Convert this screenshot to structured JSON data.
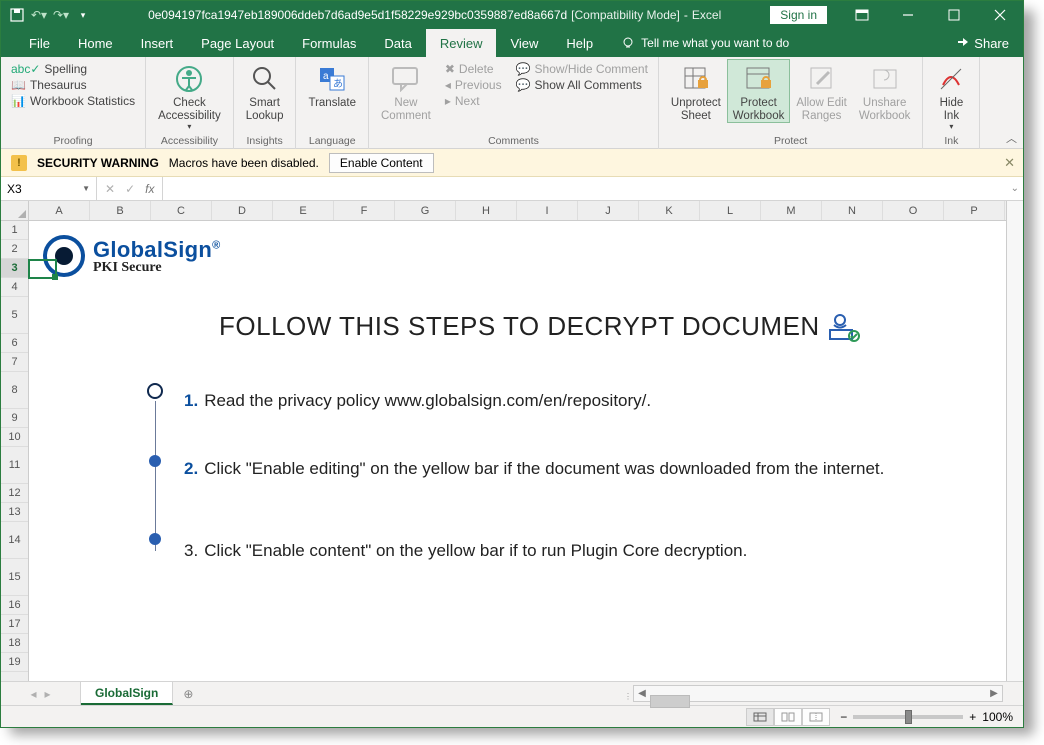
{
  "titlebar": {
    "docname": "0e094197fca1947eb189006ddeb7d6ad9e5d1f58229e929bc0359887ed8a667d",
    "mode": "[Compatibility Mode]",
    "app": "Excel",
    "signin": "Sign in"
  },
  "menu": {
    "tabs": [
      "File",
      "Home",
      "Insert",
      "Page Layout",
      "Formulas",
      "Data",
      "Review",
      "View",
      "Help"
    ],
    "active": "Review",
    "tellme": "Tell me what you want to do",
    "share": "Share"
  },
  "ribbon": {
    "proofing": {
      "label": "Proofing",
      "items": [
        "Spelling",
        "Thesaurus",
        "Workbook Statistics"
      ]
    },
    "accessibility": {
      "label": "Accessibility",
      "btn": "Check\nAccessibility"
    },
    "insights": {
      "label": "Insights",
      "btn": "Smart\nLookup"
    },
    "language": {
      "label": "Language",
      "btn": "Translate"
    },
    "comments": {
      "label": "Comments",
      "new": "New\nComment",
      "delete": "Delete",
      "previous": "Previous",
      "next": "Next",
      "showhide": "Show/Hide Comment",
      "showall": "Show All Comments"
    },
    "protect": {
      "label": "Protect",
      "unprotect": "Unprotect\nSheet",
      "workbook": "Protect\nWorkbook",
      "ranges": "Allow Edit\nRanges",
      "unshare": "Unshare\nWorkbook"
    },
    "ink": {
      "label": "Ink",
      "btn": "Hide\nInk"
    }
  },
  "securitybar": {
    "title": "SECURITY WARNING",
    "msg": "Macros have been disabled.",
    "button": "Enable Content"
  },
  "formulabar": {
    "name": "X3",
    "value": ""
  },
  "grid": {
    "columns": [
      "A",
      "B",
      "C",
      "D",
      "E",
      "F",
      "G",
      "H",
      "I",
      "J",
      "K",
      "L",
      "M",
      "N",
      "O",
      "P"
    ],
    "rows": [
      1,
      2,
      3,
      4,
      5,
      6,
      7,
      8,
      9,
      10,
      11,
      12,
      13,
      14,
      15,
      16,
      17,
      18,
      19
    ],
    "selected_row": 3
  },
  "document": {
    "logo_brand": "GlobalSign",
    "logo_sub": "PKI Secure",
    "heading": "FOLLOW THIS STEPS TO DECRYPT DOCUMEN",
    "steps": {
      "s1_num": "1.",
      "s1": "Read the privacy policy www.globalsign.com/en/repository/.",
      "s2_num": "2.",
      "s2": "Click \"Enable editing\" on the yellow bar if the document was downloaded from the internet.",
      "s3_num": "3.",
      "s3": "Click \"Enable content\" on the yellow bar if to run Plugin Core decryption."
    }
  },
  "sheettab": {
    "name": "GlobalSign"
  },
  "statusbar": {
    "zoom": "100%"
  }
}
